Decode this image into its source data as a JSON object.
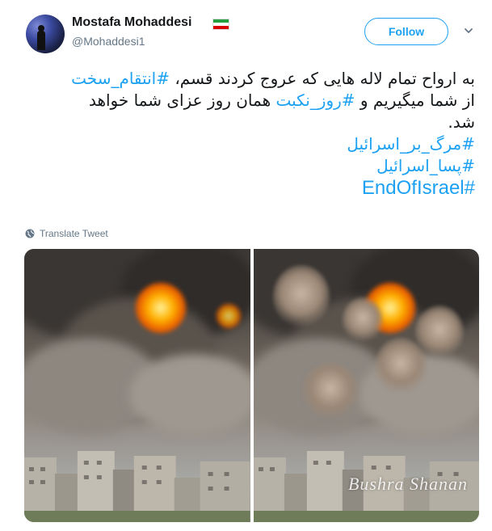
{
  "author": {
    "name": "Mostafa Mohaddesi",
    "handle": "@Mohaddesi1",
    "flag_icon": "iran-flag-icon",
    "avatar_icon": "avatar-night-sky"
  },
  "follow_label": "Follow",
  "menu_icon": "chevron-down-icon",
  "tweet": {
    "line1_text": "به ارواح تمام لاله هایی که عروج کردند قسم، ",
    "line1_tag": "#انتقام_سخت",
    "line2_pre": "از شما میگیریم و ",
    "line2_tag": "#روز_نکبت",
    "line2_post": " همان روز عزای شما خواهد",
    "line3": "شد.",
    "hashtag1": "#مرگ_بر_اسرائیل",
    "hashtag2": "#پسا_اسرائیل",
    "hashtag3": "#EndOfIsrael"
  },
  "translate_label": "Translate Tweet",
  "media": {
    "watermark": "Bushra Shanan"
  },
  "colors": {
    "accent": "#1da1f2",
    "text": "#14171a",
    "muted": "#657786"
  }
}
